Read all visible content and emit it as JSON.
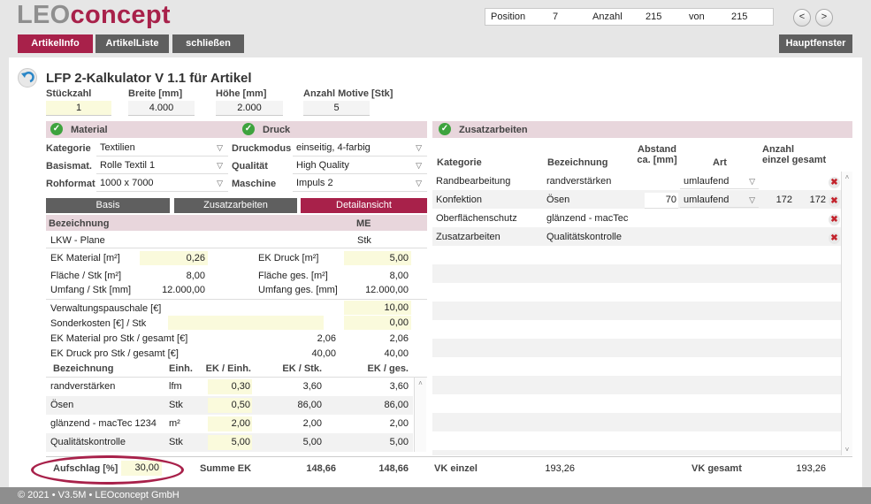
{
  "header": {
    "logo_part1": "LEO",
    "logo_part2": "concept",
    "position_label": "Position",
    "position_value": "7",
    "count_label": "Anzahl",
    "count_value": "215",
    "of_label": "von",
    "of_value": "215",
    "prev": "<",
    "next": ">"
  },
  "toolbar": {
    "artikelinfo": "ArtikelInfo",
    "artikelliste": "ArtikelListe",
    "schliessen": "schließen",
    "hauptfenster": "Hauptfenster"
  },
  "calc": {
    "title": "LFP 2-Kalkulator V 1.1 für Artikel",
    "stueckzahl_label": "Stückzahl",
    "stueckzahl": "1",
    "breite_label": "Breite [mm]",
    "breite": "4.000",
    "hoehe_label": "Höhe [mm]",
    "hoehe": "2.000",
    "motive_label": "Anzahl Motive [Stk]",
    "motive": "5"
  },
  "material": {
    "header": "Material",
    "kategorie_label": "Kategorie",
    "kategorie": "Textilien",
    "basismat_label": "Basismat.",
    "basismat": "Rolle Textil 1",
    "rohformat_label": "Rohformat",
    "rohformat": "1000 x 7000"
  },
  "druck": {
    "header": "Druck",
    "druckmodus_label": "Druckmodus",
    "druckmodus": "einseitig, 4-farbig",
    "qualitaet_label": "Qualität",
    "qualitaet": "High Quality",
    "maschine_label": "Maschine",
    "maschine": "Impuls 2"
  },
  "tabs": {
    "basis": "Basis",
    "zusatz": "Zusatzarbeiten",
    "detail": "Detailansicht"
  },
  "detail": {
    "bez_header": "Bezeichnung",
    "me_header": "ME",
    "bez_value": "LKW - Plane",
    "me_value": "Stk",
    "ek_material_label": "EK Material [m²]",
    "ek_material": "0,26",
    "ek_druck_label": "EK Druck [m²]",
    "ek_druck": "5,00",
    "flaeche_stk_label": "Fläche / Stk [m²]",
    "flaeche_stk": "8,00",
    "flaeche_ges_label": "Fläche ges. [m²]",
    "flaeche_ges": "8,00",
    "umfang_stk_label": "Umfang / Stk [mm]",
    "umfang_stk": "12.000,00",
    "umfang_ges_label": "Umfang ges. [mm]",
    "umfang_ges": "12.000,00",
    "verwaltung_label": "Verwaltungspauschale [€]",
    "verwaltung": "10,00",
    "sonder_label": "Sonderkosten [€] / Stk",
    "sonder": "0,00",
    "ek_mat_stk_label": "EK Material pro Stk / gesamt [€]",
    "ek_mat_stk": "2,06",
    "ek_mat_ges": "2,06",
    "ek_druck_stk_label": "EK Druck pro Stk / gesamt [€]",
    "ek_druck_stk": "40,00",
    "ek_druck_ges": "40,00"
  },
  "subtable": {
    "headers": [
      "Bezeichnung",
      "Einh.",
      "EK / Einh.",
      "EK / Stk.",
      "EK / ges."
    ],
    "rows": [
      {
        "bez": "randverstärken",
        "einh": "lfm",
        "ek_einh": "0,30",
        "ek_stk": "3,60",
        "ek_ges": "3,60"
      },
      {
        "bez": "Ösen",
        "einh": "Stk",
        "ek_einh": "0,50",
        "ek_stk": "86,00",
        "ek_ges": "86,00"
      },
      {
        "bez": "glänzend - macTec 1234",
        "einh": "m²",
        "ek_einh": "2,00",
        "ek_stk": "2,00",
        "ek_ges": "2,00"
      },
      {
        "bez": "Qualitätskontrolle",
        "einh": "Stk",
        "ek_einh": "5,00",
        "ek_stk": "5,00",
        "ek_ges": "5,00"
      }
    ]
  },
  "summary": {
    "aufschlag_label": "Aufschlag [%]",
    "aufschlag": "30,00",
    "summe_label": "Summe EK",
    "summe_stk": "148,66",
    "summe_ges": "148,66",
    "vk_einzel_label": "VK einzel",
    "vk_einzel": "193,26",
    "vk_gesamt_label": "VK gesamt",
    "vk_gesamt": "193,26"
  },
  "zusatz": {
    "header": "Zusatzarbeiten",
    "col_kategorie": "Kategorie",
    "col_bezeichnung": "Bezeichnung",
    "col_abstand1": "Abstand",
    "col_abstand2": "ca. [mm]",
    "col_art": "Art",
    "col_anzahl": "Anzahl",
    "col_einzel_gesamt": "einzel gesamt",
    "rows": [
      {
        "kategorie": "Randbearbeitung",
        "bezeichnung": "randverstärken",
        "abstand": "",
        "art": "umlaufend",
        "einzel": "",
        "gesamt": ""
      },
      {
        "kategorie": "Konfektion",
        "bezeichnung": "Ösen",
        "abstand": "70",
        "art": "umlaufend",
        "einzel": "172",
        "gesamt": "172"
      },
      {
        "kategorie": "Oberflächenschutz",
        "bezeichnung": "glänzend - macTec",
        "abstand": "",
        "art": "",
        "einzel": "",
        "gesamt": ""
      },
      {
        "kategorie": "Zusatzarbeiten",
        "bezeichnung": "Qualitätskontrolle",
        "abstand": "",
        "art": "",
        "einzel": "",
        "gesamt": ""
      }
    ]
  },
  "footer": "© 2021 • V3.5M • LEOconcept GmbH",
  "icons": {
    "back": "back-arrow-icon",
    "check": "check-icon",
    "delete": "delete-x-icon",
    "chevron": "chevron-down-icon"
  },
  "colors": {
    "accent": "#a8214a",
    "gray_button": "#5f5f5f",
    "input_yellow": "#fafadc",
    "section_pink": "#e8d6dc",
    "check_green": "#3ea33e"
  }
}
